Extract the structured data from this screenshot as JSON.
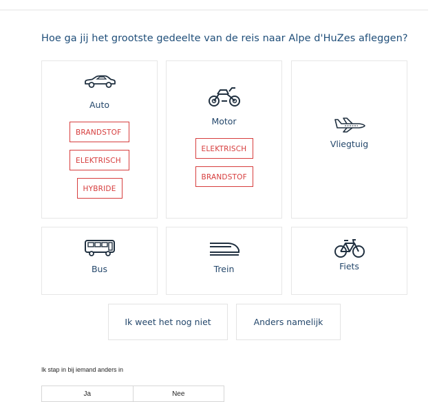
{
  "question": "Hoe ga jij het grootste gedeelte van de reis naar Alpe d'HuZes afleggen?",
  "transport": {
    "auto": {
      "label": "Auto",
      "icon": "car-icon",
      "options": [
        "BRANDSTOF",
        "ELEKTRISCH",
        "HYBRIDE"
      ]
    },
    "motor": {
      "label": "Motor",
      "icon": "motorcycle-icon",
      "options": [
        "ELEKTRISCH",
        "BRANDSTOF"
      ]
    },
    "vliegtuig": {
      "label": "Vliegtuig",
      "icon": "airplane-icon"
    },
    "bus": {
      "label": "Bus",
      "icon": "bus-icon"
    },
    "trein": {
      "label": "Trein",
      "icon": "train-icon"
    },
    "fiets": {
      "label": "Fiets",
      "icon": "bicycle-icon"
    }
  },
  "buttons": {
    "unknown": "Ik weet het nog niet",
    "other": "Anders namelijk"
  },
  "carpool": {
    "label": "Ik stap in bij iemand anders in",
    "yes": "Ja",
    "no": "Nee"
  },
  "colors": {
    "accent": "#1f4e79",
    "option_red": "#d63b3b",
    "border": "#e6e6e6"
  }
}
